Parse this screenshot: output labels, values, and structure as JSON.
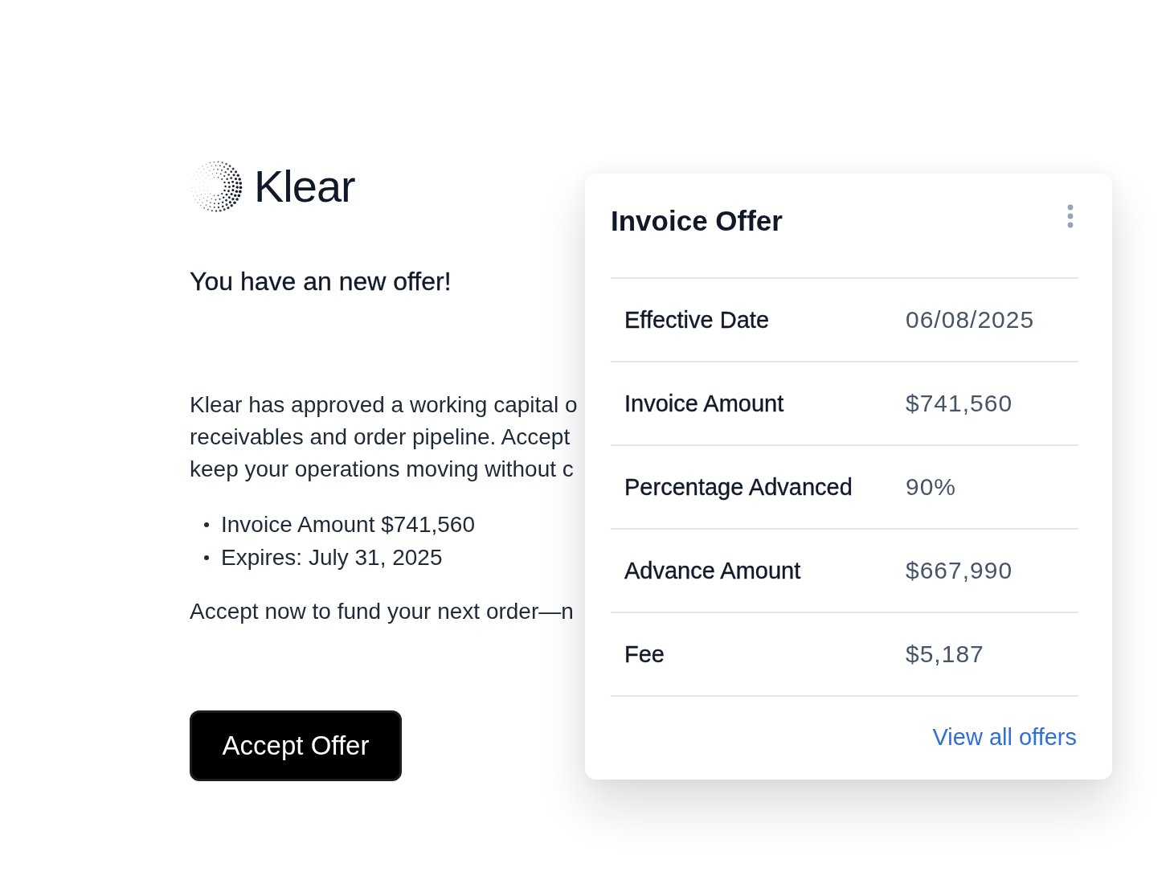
{
  "logo": {
    "wordmark": "Klear"
  },
  "email": {
    "heading": "You have an new offer!",
    "paragraph_lines": [
      "Klear has approved a working capital o",
      "receivables and order pipeline. Accept",
      "keep your operations moving without c"
    ],
    "bullets": [
      "Invoice Amount $741,560",
      "Expires: July 31, 2025"
    ],
    "closing_line": "Accept now to fund your next order—n",
    "button": "Accept Offer"
  },
  "card": {
    "title": "Invoice Offer",
    "rows": [
      {
        "label": "Effective Date",
        "value": "06/08/2025"
      },
      {
        "label": "Invoice Amount",
        "value": "$741,560"
      },
      {
        "label": "Percentage Advanced",
        "value": "90%"
      },
      {
        "label": "Advance Amount",
        "value": "$667,990"
      },
      {
        "label": "Fee",
        "value": "$5,187"
      }
    ],
    "link": "View all offers"
  }
}
